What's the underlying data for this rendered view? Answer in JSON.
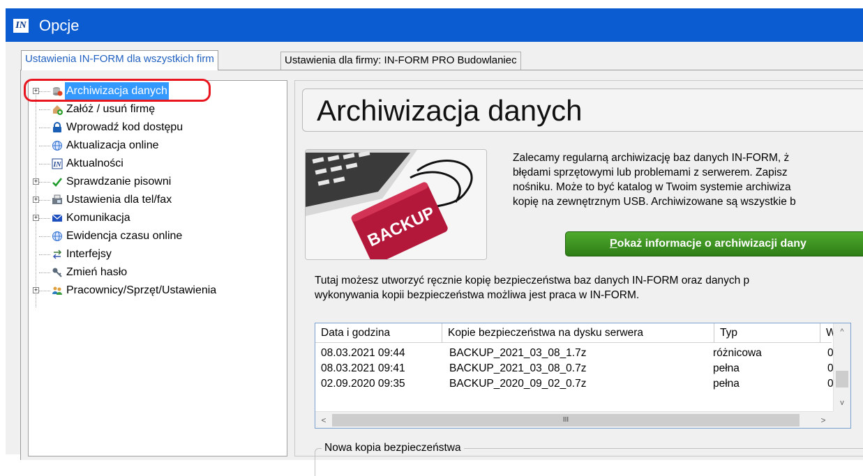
{
  "window": {
    "title": "Opcje",
    "app_icon": "IN"
  },
  "tabs": [
    {
      "label": "Ustawienia IN-FORM dla wszystkich firm",
      "active": true
    },
    {
      "label": "Ustawienia dla firmy: IN-FORM PRO Budowlaniec",
      "active": false
    }
  ],
  "tree": {
    "items": [
      {
        "label": "Archiwizacja danych",
        "icon": "archive-icon",
        "expandable": true,
        "selected": true
      },
      {
        "label": "Załóż / usuń firmę",
        "icon": "add-company-icon",
        "expandable": false
      },
      {
        "label": "Wprowadź kod dostępu",
        "icon": "lock-icon",
        "expandable": false
      },
      {
        "label": "Aktualizacja online",
        "icon": "globe-icon",
        "expandable": false
      },
      {
        "label": "Aktualności",
        "icon": "inform-logo-icon",
        "expandable": false
      },
      {
        "label": "Sprawdzanie pisowni",
        "icon": "checkmark-icon",
        "expandable": true
      },
      {
        "label": "Ustawienia dla tel/fax",
        "icon": "fax-icon",
        "expandable": true
      },
      {
        "label": "Komunikacja",
        "icon": "envelope-icon",
        "expandable": true
      },
      {
        "label": "Ewidencja czasu online",
        "icon": "globe-icon",
        "expandable": false
      },
      {
        "label": "Interfejsy",
        "icon": "arrows-icon",
        "expandable": false
      },
      {
        "label": "Zmień hasło",
        "icon": "key-icon",
        "expandable": false
      },
      {
        "label": "Pracownicy/Sprzęt/Ustawienia",
        "icon": "people-icon",
        "expandable": true
      }
    ]
  },
  "content": {
    "heading": "Archiwizacja danych",
    "image_text": "BACKUP",
    "intro_lines": [
      "Zalecamy regularną archiwizację baz danych IN-FORM, ż",
      "błędami sprzętowymi lub problemami z serwerem. Zapisz",
      "nośniku. Może to być katalog w Twoim systemie archiwiza",
      "kopię na zewnętrznym USB. Archiwizowane są wszystkie b"
    ],
    "show_info_button": {
      "accel": "P",
      "rest": "okaż informacje o archiwizacji dany"
    },
    "desc_lines": [
      "Tutaj możesz utworzyć ręcznie kopię bezpieczeństwa baz danych IN-FORM oraz danych p",
      "wykonywania kopii bezpieczeństwa możliwa jest praca w IN-FORM."
    ],
    "backup_table": {
      "columns": [
        "Data i godzina",
        "Kopie bezpieczeństwa na dysku serwera",
        "Typ",
        "W"
      ],
      "rows": [
        [
          "08.03.2021 09:44",
          "BACKUP_2021_03_08_1.7z",
          "różnicowa",
          "0"
        ],
        [
          "08.03.2021 09:41",
          "BACKUP_2021_03_08_0.7z",
          "pełna",
          "0"
        ],
        [
          "02.09.2020 09:35",
          "BACKUP_2020_09_02_0.7z",
          "pełna",
          "0"
        ]
      ],
      "hscroll_grip": "III"
    },
    "new_backup_group": "Nowa kopia bezpieczeństwa"
  },
  "colors": {
    "titlebar": "#0b5cd0",
    "selection": "#3399ff",
    "button_green": "#2e7d16",
    "highlight_red": "#e8141e"
  }
}
